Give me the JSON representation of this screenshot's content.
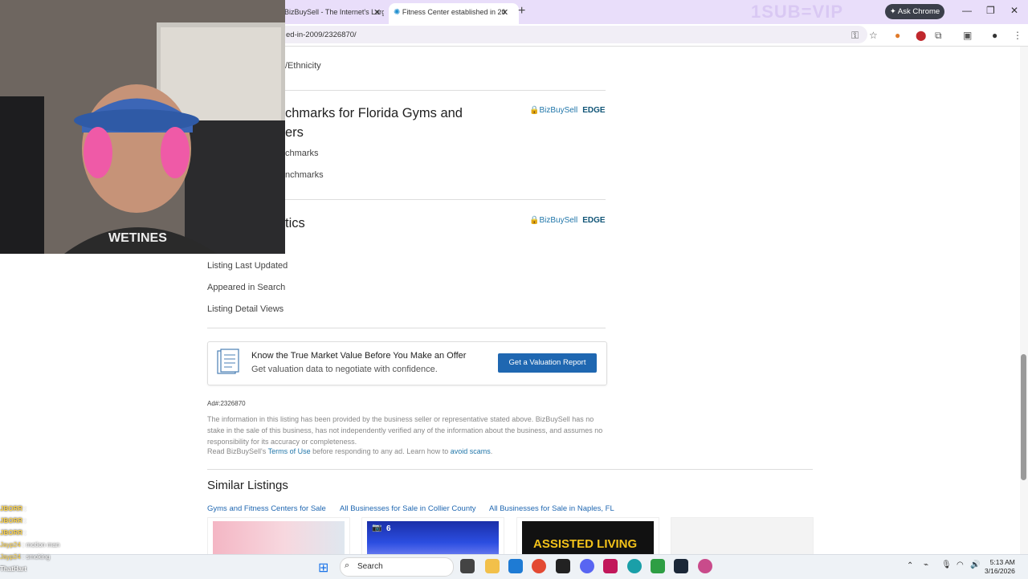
{
  "browser": {
    "tabs": [
      {
        "label": "BizBuySell - The Internet's Larg",
        "active": false
      },
      {
        "label": "Fitness Center established in 20",
        "active": true
      }
    ],
    "overlay_text": "1SUB=VIP",
    "ask_chrome": "Ask Chrome",
    "url": "ed-in-2009/2326870/"
  },
  "sections": {
    "ethnicity_label": "/Ethnicity",
    "benchmarks": {
      "title": "chmarks for Florida Gyms and",
      "title_line2": "ers",
      "rows": [
        "chmarks",
        "nchmarks"
      ],
      "badge_name": "BizBuySell",
      "badge_tag": "EDGE"
    },
    "statistics": {
      "title": "tics",
      "rows": [
        "Listing Last Updated",
        "Appeared in Search",
        "Listing Detail Views"
      ],
      "badge_name": "BizBuySell",
      "badge_tag": "EDGE"
    }
  },
  "valuation": {
    "title": "Know the True Market Value Before You Make an Offer",
    "subtitle": "Get valuation data to negotiate with confidence.",
    "button": "Get a Valuation Report"
  },
  "ad": {
    "number": "Ad#:2326870",
    "disclaimer": "The information in this listing has been provided by the business seller or representative stated above. BizBuySell has no stake in the sale of this business, has not independently verified any of the information about the business, and assumes no responsibility for its accuracy or completeness.",
    "terms_prefix": "Read BizBuySell's ",
    "terms_link": "Terms of Use",
    "terms_middle": " before responding to any ad. Learn how to ",
    "scams_link": "avoid scams",
    "terms_suffix": "."
  },
  "similar": {
    "title": "Similar Listings",
    "links": [
      "Gyms and Fitness Centers for Sale",
      "All Businesses for Sale in Collier County",
      "All Businesses for Sale in Naples, FL"
    ],
    "photo_count": "6",
    "card3_text": "ASSISTED LIVING"
  },
  "taskbar": {
    "search": "Search",
    "time": "5:13 AM",
    "date": "3/16/2026"
  },
  "webcam": {
    "shirt_text": "WETINES"
  },
  "chat": [
    {
      "user": "JBORR",
      "msg": ""
    },
    {
      "user": "JBORR",
      "msg": ""
    },
    {
      "user": "JBORR",
      "msg": ""
    },
    {
      "user": "Jayp24",
      "msg": "motion man"
    },
    {
      "user": "Jayp24",
      "msg": "smoking"
    },
    {
      "user": "ThatHart",
      "msg": ""
    }
  ],
  "colors": {
    "tabstrip": "#e9defa",
    "link": "#1f67b1",
    "button": "#1f67b1"
  }
}
